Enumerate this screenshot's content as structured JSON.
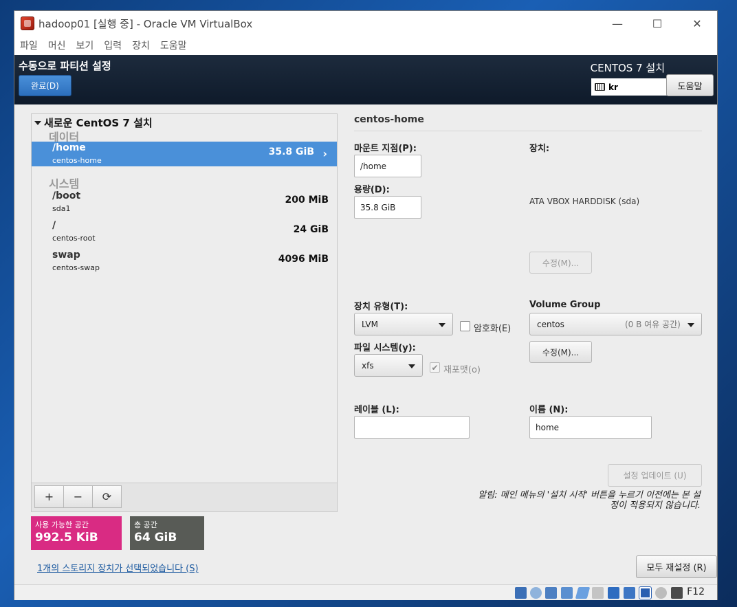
{
  "window": {
    "title": "hadoop01 [실행 중] - Oracle VM VirtualBox",
    "minimize": "—",
    "maximize": "☐",
    "close": "✕"
  },
  "menu": [
    "파일",
    "머신",
    "보기",
    "입력",
    "장치",
    "도움말"
  ],
  "header": {
    "title": "수동으로 파티션 설정",
    "done_label": "완료(D)",
    "install_title": "CENTOS 7 설치",
    "keyboard": "kr",
    "help_label": "도움말"
  },
  "tree": {
    "root": "새로운 CentOS 7 설치",
    "data_section": "데이터",
    "system_section": "시스템",
    "data_partitions": [
      {
        "mount": "/home",
        "device": "centos-home",
        "size": "35.8 GiB",
        "selected": true
      }
    ],
    "system_partitions": [
      {
        "mount": "/boot",
        "device": "sda1",
        "size": "200 MiB"
      },
      {
        "mount": "/",
        "device": "centos-root",
        "size": "24 GiB"
      },
      {
        "mount": "swap",
        "device": "centos-swap",
        "size": "4096 MiB"
      }
    ],
    "chevron": "›"
  },
  "toolbar": {
    "add": "+",
    "remove": "−",
    "refresh": "⟳"
  },
  "space": {
    "available_label": "사용 가능한 공간",
    "available_value": "992.5 KiB",
    "total_label": "총 공간",
    "total_value": "64 GiB"
  },
  "storage_link": "1개의 스토리지 장치가 선택되었습니다 (S)",
  "reset_label": "모두 재설정 (R)",
  "detail": {
    "title": "centos-home",
    "mount_label": "마운트 지점(P):",
    "mount_value": "/home",
    "capacity_label": "용량(D):",
    "capacity_value": "35.8 GiB",
    "device_label": "장치:",
    "device_value": "ATA VBOX HARDDISK (sda)",
    "modify_disabled": "수정(M)...",
    "device_type_label": "장치 유형(T):",
    "device_type_value": "LVM",
    "encrypt_label": "암호화(E)",
    "vg_label": "Volume Group",
    "vg_value": "centos",
    "vg_free": "(0 B 여유 공간)",
    "modify_vg": "수정(M)...",
    "fs_label": "파일 시스템(y):",
    "fs_value": "xfs",
    "reformat_label": "재포맷(o)",
    "label_label": "레이블 (L):",
    "label_value": "",
    "name_label": "이름 (N):",
    "name_value": "home",
    "update_label": "설정 업데이트 (U)",
    "note": "알림: 메인 메뉴의 '설치 시작' 버튼을 누르기 이전에는 본 설정이 적용되지 않습니다."
  },
  "statusbar": {
    "host_key": "F12"
  },
  "colors": {
    "accent": "#4a90d9",
    "available": "#d92b83",
    "total": "#585b56",
    "header": "#1d2b3d"
  }
}
